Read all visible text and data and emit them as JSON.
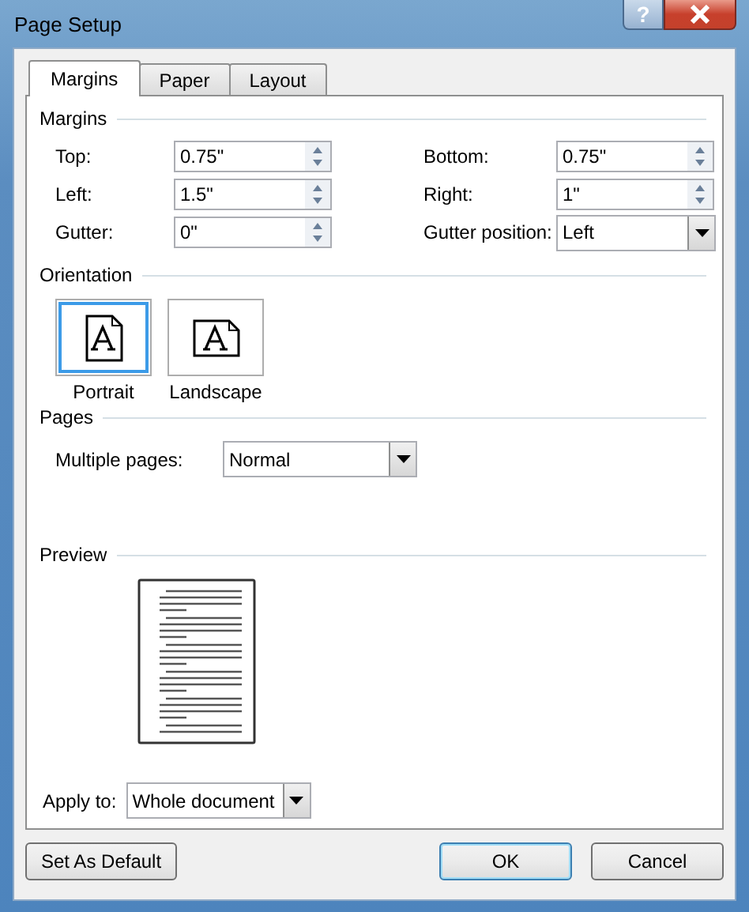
{
  "window": {
    "title": "Page Setup",
    "help": "?"
  },
  "tabs": [
    {
      "label": "Margins",
      "selected": true
    },
    {
      "label": "Paper",
      "selected": false
    },
    {
      "label": "Layout",
      "selected": false
    }
  ],
  "margins": {
    "title": "Margins",
    "fields": [
      {
        "label": "Top:",
        "value": "0.75\"",
        "kind": "spin"
      },
      {
        "label": "Bottom:",
        "value": "0.75\"",
        "kind": "spin"
      },
      {
        "label": "Left:",
        "value": "1.5\"",
        "kind": "spin"
      },
      {
        "label": "Right:",
        "value": "1\"",
        "kind": "spin"
      },
      {
        "label": "Gutter:",
        "value": "0\"",
        "kind": "spin"
      },
      {
        "label": "Gutter position:",
        "value": "Left",
        "kind": "dropdown"
      }
    ]
  },
  "orientation": {
    "title": "Orientation",
    "options": [
      {
        "label": "Portrait",
        "kind": "portrait",
        "selected": true
      },
      {
        "label": "Landscape",
        "kind": "landscape",
        "selected": false
      }
    ]
  },
  "pages": {
    "title": "Pages",
    "multiple_pages": {
      "label": "Multiple pages:",
      "value": "Normal"
    }
  },
  "preview": {
    "title": "Preview"
  },
  "apply_to": {
    "label": "Apply to:",
    "value": "Whole document"
  },
  "buttons": [
    {
      "label": "Set As Default",
      "kind": "left",
      "default": false
    },
    {
      "label": "OK",
      "kind": "right",
      "default": true
    },
    {
      "label": "Cancel",
      "kind": "right",
      "default": false
    }
  ]
}
